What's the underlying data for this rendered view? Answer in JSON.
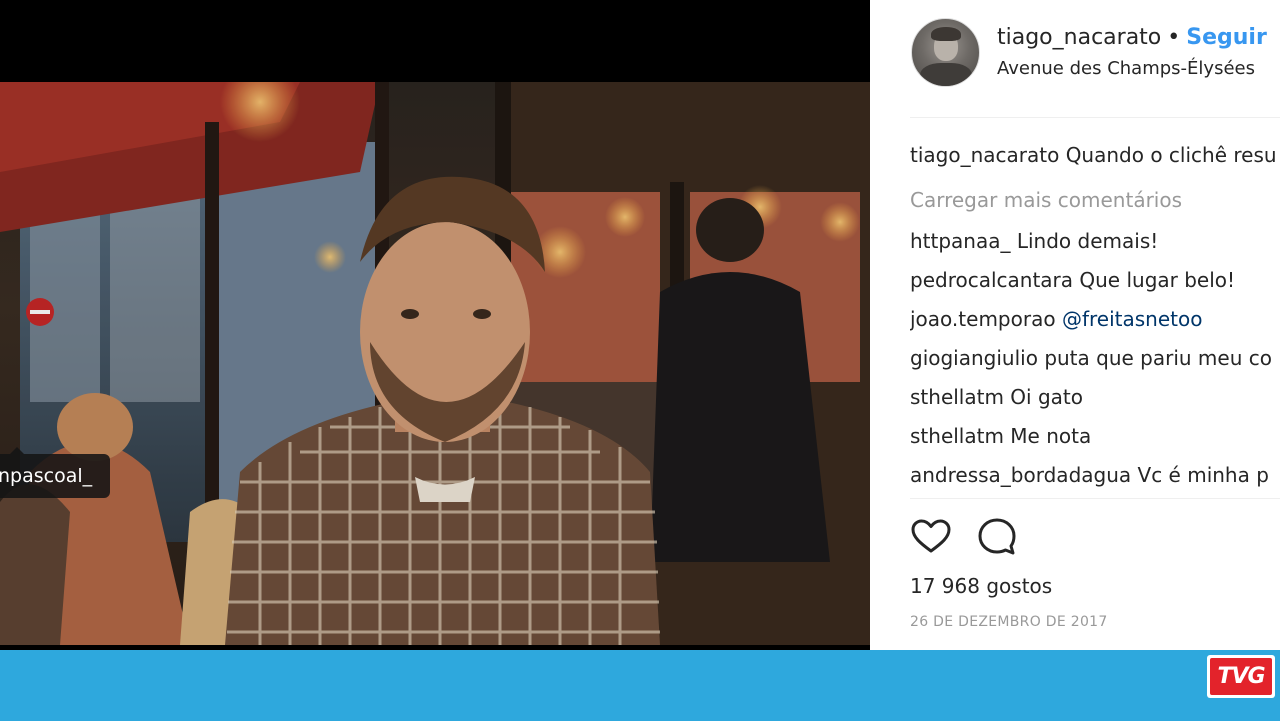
{
  "photo": {
    "tagged_user": "npascoal_"
  },
  "post_header": {
    "username": "tiago_nacarato",
    "separator": "•",
    "follow_label": "Seguir",
    "location": "Avenue des Champs-Élysées"
  },
  "caption": {
    "username": "tiago_nacarato",
    "text": "Quando o clichê resu"
  },
  "load_more_label": "Carregar mais comentários",
  "comments": [
    {
      "username": "httpanaa_",
      "text": "Lindo demais!"
    },
    {
      "username": "pedrocalcantara",
      "text": "Que lugar belo!"
    },
    {
      "username": "joao.temporao",
      "text": "@freitasnetoo",
      "is_mention": true
    },
    {
      "username": "giogiangiulio",
      "text": "puta que pariu meu co"
    },
    {
      "username": "sthellatm",
      "text": "Oi gato"
    },
    {
      "username": "sthellatm",
      "text": "Me nota"
    },
    {
      "username": "andressa_bordadagua",
      "text": "Vc é minha p"
    }
  ],
  "actions": {
    "like_icon": "heart-icon",
    "comment_icon": "speech-bubble-icon"
  },
  "likes_text": "17 968 gostos",
  "date_text": "26 DE DEZEMBRO DE 2017",
  "colors": {
    "follow": "#3897f0",
    "bottom_bar": "#2ea8dd",
    "logo_red": "#e3232b"
  },
  "logo_text": "TVG"
}
